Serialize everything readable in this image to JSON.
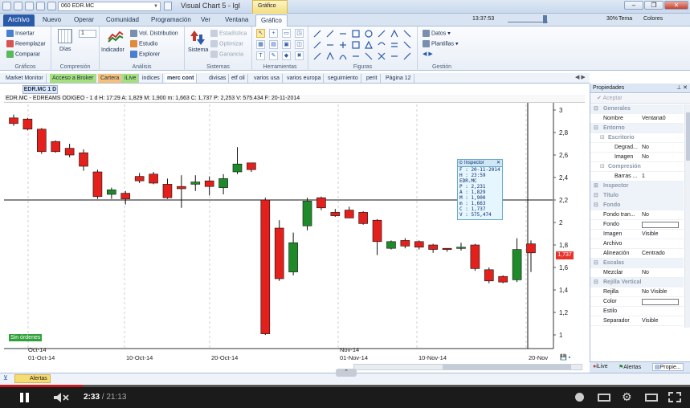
{
  "window": {
    "title": "Visual Chart 5 - Igl",
    "symbol": "060 EDR.MC",
    "context_tab": "Gráfico",
    "clock": "13:37:53",
    "zoom": "30%",
    "tema_label": "Tema",
    "colores_label": "Colores"
  },
  "tabs": [
    "Archivo",
    "Nuevo",
    "Operar",
    "Comunidad",
    "Programación",
    "Ver",
    "Ventana",
    "Gráfico"
  ],
  "ribbon": {
    "graficos": {
      "label": "Gráficos",
      "items": [
        "Insertar",
        "Reemplazar",
        "Comparar"
      ]
    },
    "compresion": {
      "label": "Compresión",
      "dias": "Días",
      "value": "1"
    },
    "analisis": {
      "label": "Análisis",
      "indicador": "Indicador",
      "items": [
        "Vol. Distribution",
        "Estudio",
        "Explorer"
      ]
    },
    "sistemas": {
      "label": "Sistemas",
      "sistema": "Sistema",
      "items": [
        "Estadística",
        "Optimizar",
        "Ganancia"
      ]
    },
    "herramientas": {
      "label": "Herramientas"
    },
    "figuras": {
      "label": "Figuras"
    },
    "gestion": {
      "label": "Gestión",
      "items": [
        "Datos",
        "Plantillas"
      ]
    }
  },
  "sheet_tabs": [
    "Market Monitor",
    "Acceso a Broker",
    "Cartera",
    "iLive",
    "indices",
    "merc cont",
    "divisas",
    "etf oil",
    "varios usa",
    "varios europa",
    "seguimiento",
    "perit",
    "Página 12"
  ],
  "chart": {
    "window_tab": "EDR.MC 1 D",
    "header": "EDR.MC - EDREAMS ODIGEO - 1 d  H: 17:29  A: 1,829  M: 1,900  m: 1,663  C: 1,737  P: 2,253  V: 575.434  F: 20-11-2014",
    "sin_ordenes": "Sin órdenes",
    "last_price_tag": "1,737",
    "date_labels": [
      "Oct-14",
      "01-Oct-14",
      "10-Oct-14",
      "20-Oct-14",
      "Nov-14",
      "01-Nov-14",
      "10-Nov-14",
      "20-Nov"
    ],
    "inspector": {
      "title": "Inspector",
      "rows": [
        "F : 20-11-2014",
        "H : 23:59",
        "EDR.MC",
        "P : 2,231",
        "A : 1,829",
        "M : 1,900",
        "m : 1,663",
        "C : 1,737",
        "V : 575,474"
      ]
    }
  },
  "chart_data": {
    "type": "candlestick",
    "title": "EDR.MC - EDREAMS ODIGEO - 1 d",
    "y_ticks": [
      "3",
      "2,8",
      "2,6",
      "2,4",
      "2,2",
      "2",
      "1,8",
      "1,6",
      "1,4",
      "1,2",
      "1"
    ],
    "ylim": [
      0.95,
      3.05
    ],
    "candles": [
      {
        "o": 2.93,
        "h": 2.96,
        "l": 2.86,
        "c": 2.88
      },
      {
        "o": 2.92,
        "h": 2.93,
        "l": 2.82,
        "c": 2.83
      },
      {
        "o": 2.83,
        "h": 2.84,
        "l": 2.61,
        "c": 2.63
      },
      {
        "o": 2.72,
        "h": 2.73,
        "l": 2.62,
        "c": 2.63
      },
      {
        "o": 2.66,
        "h": 2.7,
        "l": 2.58,
        "c": 2.6
      },
      {
        "o": 2.62,
        "h": 2.65,
        "l": 2.46,
        "c": 2.5
      },
      {
        "o": 2.45,
        "h": 2.47,
        "l": 2.21,
        "c": 2.23
      },
      {
        "o": 2.25,
        "h": 2.31,
        "l": 2.21,
        "c": 2.29
      },
      {
        "o": 2.26,
        "h": 2.28,
        "l": 2.16,
        "c": 2.21
      },
      {
        "o": 2.41,
        "h": 2.44,
        "l": 2.35,
        "c": 2.37
      },
      {
        "o": 2.43,
        "h": 2.45,
        "l": 2.34,
        "c": 2.35
      },
      {
        "o": 2.34,
        "h": 2.39,
        "l": 2.21,
        "c": 2.22
      },
      {
        "o": 2.32,
        "h": 2.42,
        "l": 2.13,
        "c": 2.3
      },
      {
        "o": 2.34,
        "h": 2.42,
        "l": 2.28,
        "c": 2.36
      },
      {
        "o": 2.37,
        "h": 2.41,
        "l": 2.24,
        "c": 2.32
      },
      {
        "o": 2.31,
        "h": 2.43,
        "l": 2.25,
        "c": 2.39
      },
      {
        "o": 2.45,
        "h": 2.67,
        "l": 2.43,
        "c": 2.52
      },
      {
        "o": 2.53,
        "h": 2.53,
        "l": 2.45,
        "c": 2.47
      },
      {
        "o": 2.2,
        "h": 2.22,
        "l": 1.0,
        "c": 1.01
      },
      {
        "o": 1.95,
        "h": 2.02,
        "l": 1.48,
        "c": 1.5
      },
      {
        "o": 1.56,
        "h": 1.91,
        "l": 1.53,
        "c": 1.82
      },
      {
        "o": 1.97,
        "h": 2.22,
        "l": 1.93,
        "c": 2.19
      },
      {
        "o": 2.22,
        "h": 2.23,
        "l": 2.11,
        "c": 2.13
      },
      {
        "o": 2.09,
        "h": 2.12,
        "l": 2.05,
        "c": 2.06
      },
      {
        "o": 2.11,
        "h": 2.14,
        "l": 2.06,
        "c": 2.04
      },
      {
        "o": 2.09,
        "h": 2.1,
        "l": 1.98,
        "c": 1.99
      },
      {
        "o": 2.02,
        "h": 2.03,
        "l": 1.71,
        "c": 1.83
      },
      {
        "o": 1.77,
        "h": 1.84,
        "l": 1.76,
        "c": 1.83
      },
      {
        "o": 1.84,
        "h": 1.86,
        "l": 1.77,
        "c": 1.79
      },
      {
        "o": 1.83,
        "h": 1.84,
        "l": 1.76,
        "c": 1.78
      },
      {
        "o": 1.8,
        "h": 1.81,
        "l": 1.73,
        "c": 1.76
      },
      {
        "o": 1.77,
        "h": 1.77,
        "l": 1.74,
        "c": 1.76
      },
      {
        "o": 1.77,
        "h": 1.82,
        "l": 1.75,
        "c": 1.78
      },
      {
        "o": 1.8,
        "h": 1.81,
        "l": 1.57,
        "c": 1.59
      },
      {
        "o": 1.58,
        "h": 1.6,
        "l": 1.46,
        "c": 1.48
      },
      {
        "o": 1.52,
        "h": 1.53,
        "l": 1.46,
        "c": 1.47
      },
      {
        "o": 1.49,
        "h": 1.86,
        "l": 1.47,
        "c": 1.76
      },
      {
        "o": 1.81,
        "h": 1.84,
        "l": 1.56,
        "c": 1.73
      }
    ],
    "up_color": "#1f8a2a",
    "down_color": "#e3201b",
    "grid": false
  },
  "properties": {
    "title": "Propiedades",
    "aceptar": "Aceptar",
    "rows": [
      {
        "type": "cat",
        "k": "Generales"
      },
      {
        "type": "row",
        "k": "Nombre",
        "v": "Ventana0"
      },
      {
        "type": "cat",
        "k": "Entorno"
      },
      {
        "type": "subcat",
        "k": "Escritorio"
      },
      {
        "type": "sub",
        "k": "Degrad...",
        "v": "No"
      },
      {
        "type": "sub",
        "k": "Imagen",
        "v": "No"
      },
      {
        "type": "subcat",
        "k": "Compresión"
      },
      {
        "type": "sub",
        "k": "Barras ...",
        "v": "1"
      },
      {
        "type": "cat2",
        "k": "Inspector"
      },
      {
        "type": "cat",
        "k": "Título"
      },
      {
        "type": "cat",
        "k": "Fondo"
      },
      {
        "type": "row",
        "k": "Fondo tran...",
        "v": "No"
      },
      {
        "type": "rowc",
        "k": "Fondo",
        "v": ""
      },
      {
        "type": "row",
        "k": "Imagen",
        "v": "Visible"
      },
      {
        "type": "row",
        "k": "Archivo",
        "v": ""
      },
      {
        "type": "row",
        "k": "Alineación",
        "v": "Centrado"
      },
      {
        "type": "cat",
        "k": "Escalas"
      },
      {
        "type": "row",
        "k": "Mezclar",
        "v": "No"
      },
      {
        "type": "cat",
        "k": "Rejilla Vertical"
      },
      {
        "type": "row",
        "k": "Rejilla",
        "v": "No Visible"
      },
      {
        "type": "rowc",
        "k": "Color",
        "v": ""
      },
      {
        "type": "row",
        "k": "Estilo",
        "v": ""
      },
      {
        "type": "row",
        "k": "Separador",
        "v": "Visible"
      }
    ]
  },
  "dock": [
    "iLive",
    "Alertas",
    "Propie..."
  ],
  "alerts_tab": "Alertas",
  "player": {
    "current": "2:33",
    "duration": "21:13",
    "progress": 0.12
  }
}
